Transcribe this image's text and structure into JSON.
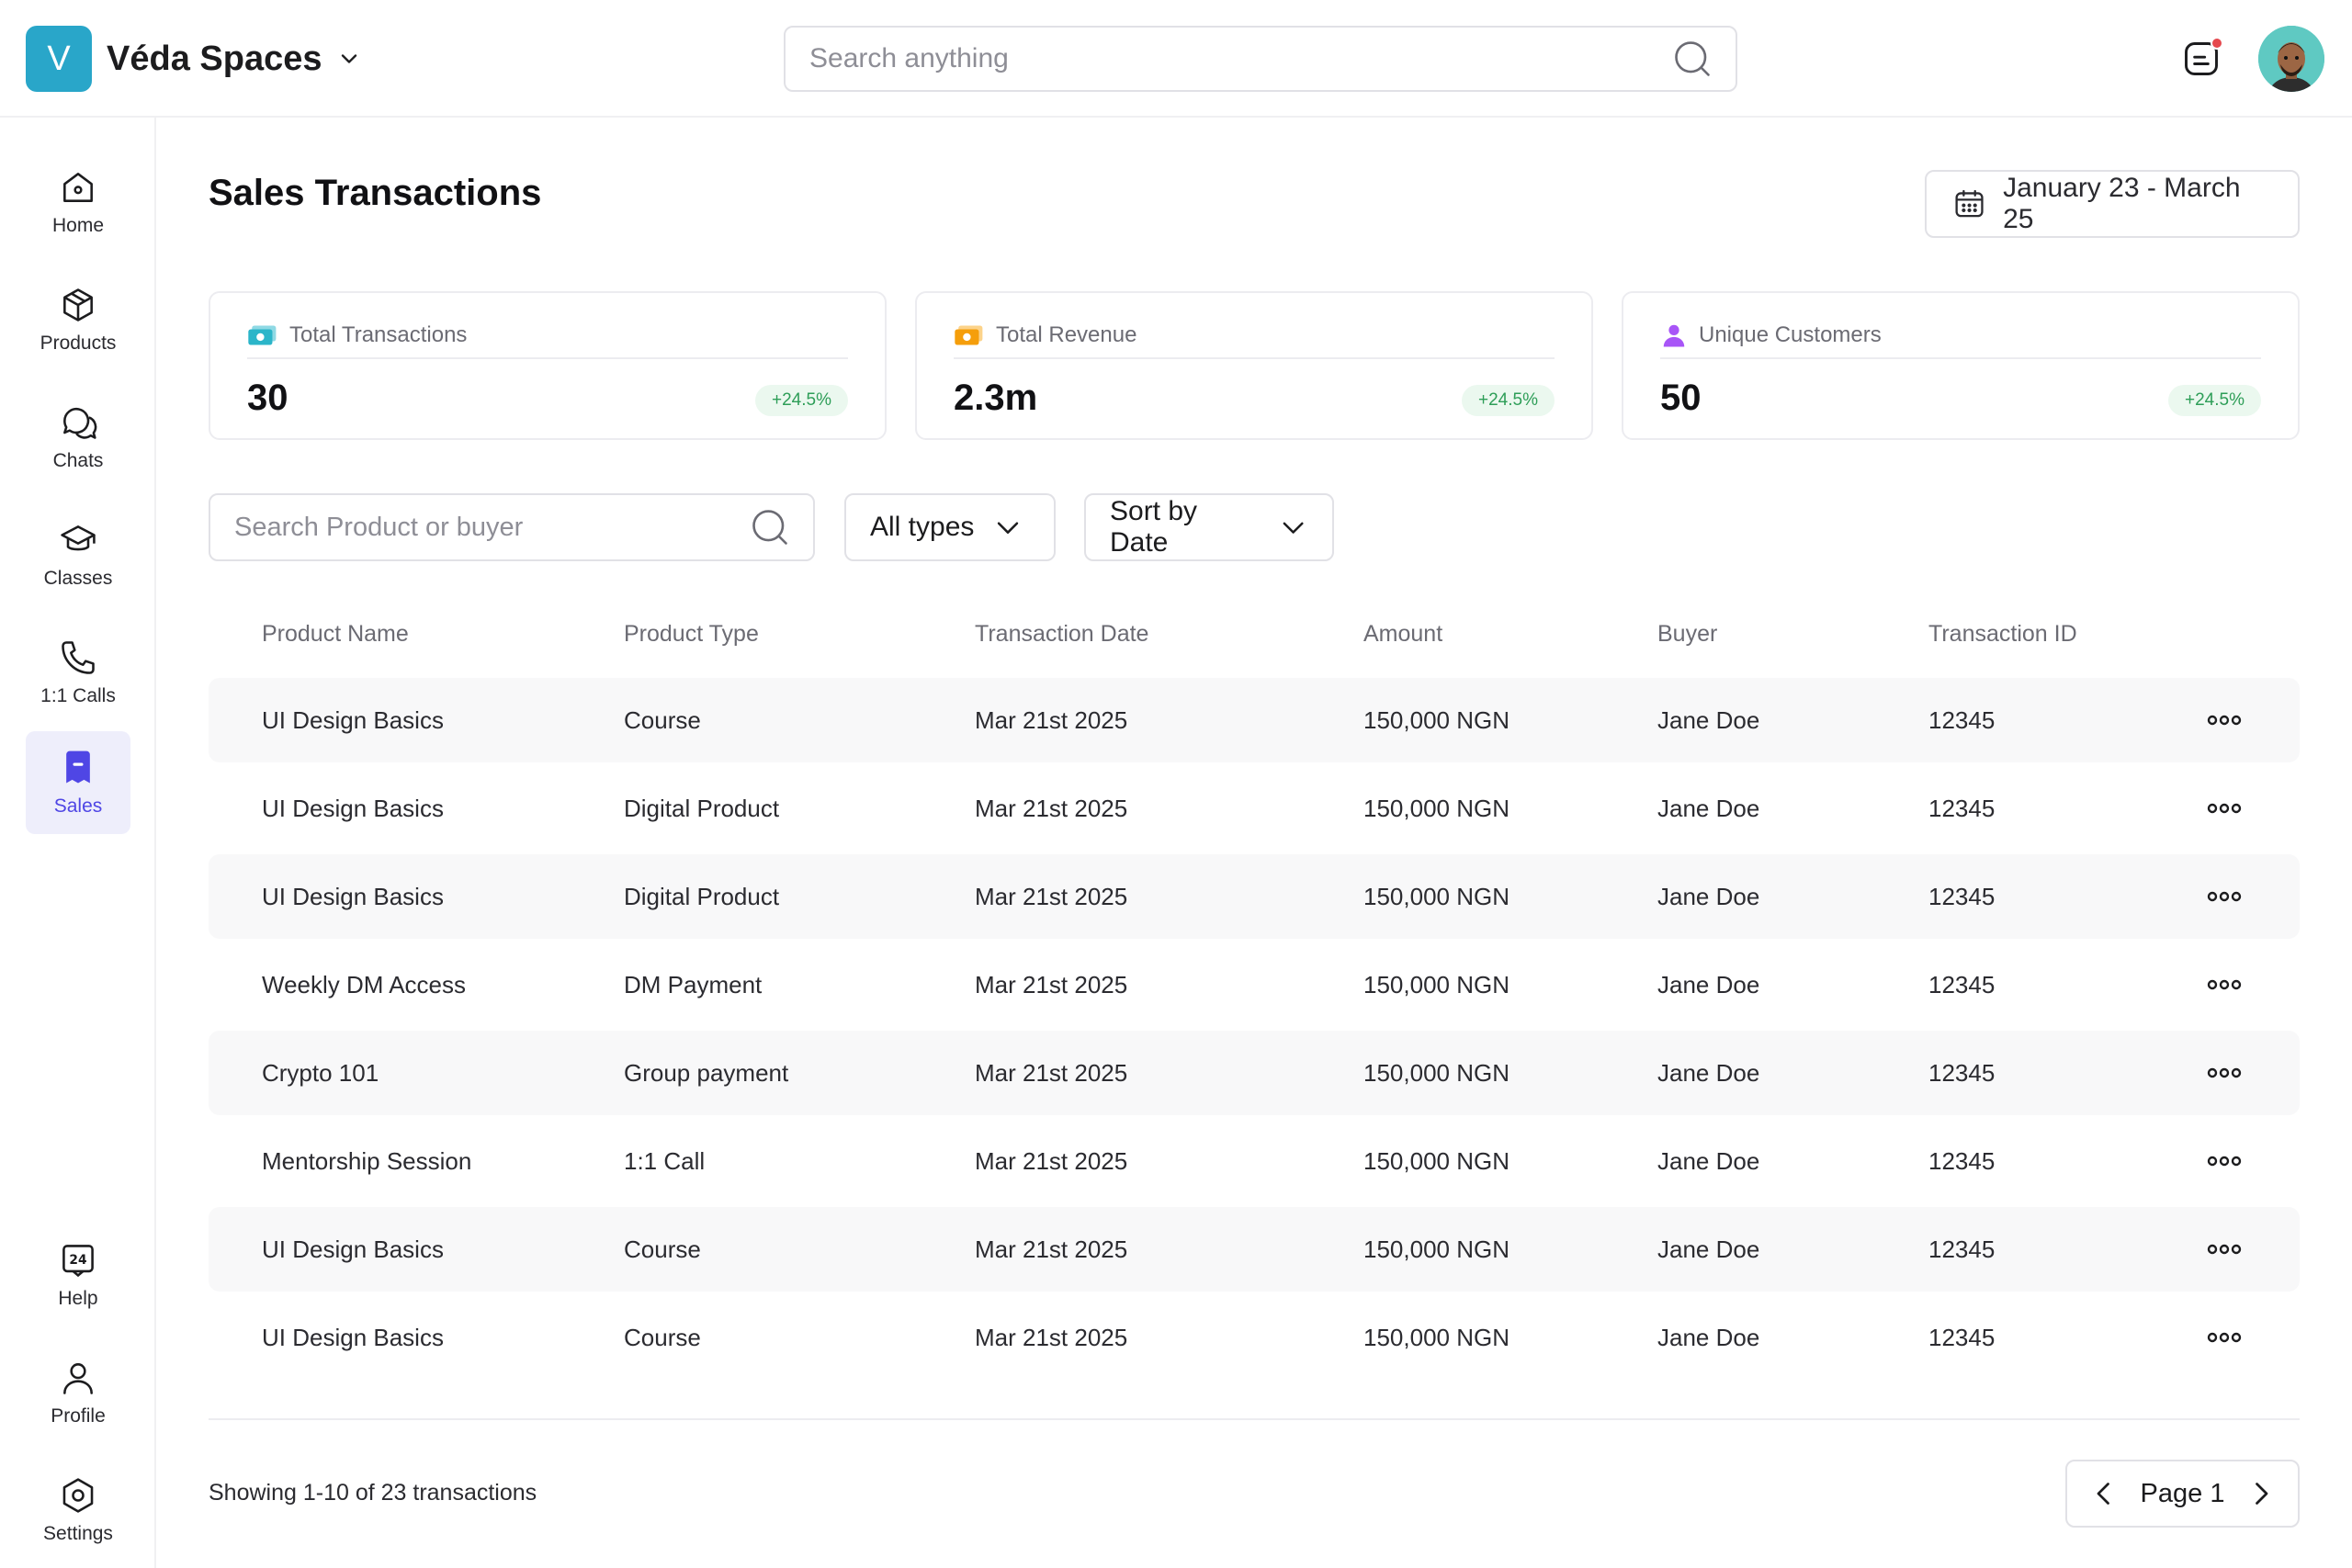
{
  "app": {
    "logo_letter": "V",
    "name": "Véda Spaces",
    "search_placeholder": "Search anything"
  },
  "sidebar": {
    "items": [
      {
        "label": "Home",
        "icon": "home-icon"
      },
      {
        "label": "Products",
        "icon": "box-icon"
      },
      {
        "label": "Chats",
        "icon": "chat-icon"
      },
      {
        "label": "Classes",
        "icon": "graduation-cap-icon"
      },
      {
        "label": "1:1 Calls",
        "icon": "phone-icon"
      },
      {
        "label": "Sales",
        "icon": "receipt-icon",
        "active": true
      }
    ],
    "bottom": [
      {
        "label": "Help",
        "icon": "help-24-icon"
      },
      {
        "label": "Profile",
        "icon": "user-icon"
      },
      {
        "label": "Settings",
        "icon": "gear-icon"
      }
    ]
  },
  "page": {
    "title": "Sales Transactions",
    "date_range": "January 23 - March 25"
  },
  "stats": [
    {
      "label": "Total Transactions",
      "value": "30",
      "change": "+24.5%",
      "icon": "cash-icon",
      "icon_color": "#2bb5c9"
    },
    {
      "label": "Total Revenue",
      "value": "2.3m",
      "change": "+24.5%",
      "icon": "cash-icon",
      "icon_color": "#f59e0b"
    },
    {
      "label": "Unique Customers",
      "value": "50",
      "change": "+24.5%",
      "icon": "user-icon",
      "icon_color": "#a855f7"
    }
  ],
  "filters": {
    "search_placeholder": "Search Product or buyer",
    "type_label": "All types",
    "sort_label": "Sort by Date"
  },
  "table": {
    "columns": [
      "Product Name",
      "Product Type",
      "Transaction Date",
      "Amount",
      "Buyer",
      "Transaction ID"
    ],
    "rows": [
      [
        "UI Design Basics",
        "Course",
        "Mar 21st 2025",
        "150,000 NGN",
        "Jane Doe",
        "12345"
      ],
      [
        "UI Design Basics",
        "Digital Product",
        "Mar 21st 2025",
        "150,000 NGN",
        "Jane Doe",
        "12345"
      ],
      [
        "UI Design Basics",
        "Digital Product",
        "Mar 21st 2025",
        "150,000 NGN",
        "Jane Doe",
        "12345"
      ],
      [
        "Weekly DM Access",
        "DM Payment",
        "Mar 21st 2025",
        "150,000 NGN",
        "Jane Doe",
        "12345"
      ],
      [
        "Crypto 101",
        "Group payment",
        "Mar 21st 2025",
        "150,000 NGN",
        "Jane Doe",
        "12345"
      ],
      [
        "Mentorship Session",
        "1:1 Call",
        "Mar 21st 2025",
        "150,000 NGN",
        "Jane Doe",
        "12345"
      ],
      [
        "UI Design Basics",
        "Course",
        "Mar 21st 2025",
        "150,000 NGN",
        "Jane Doe",
        "12345"
      ],
      [
        "UI Design Basics",
        "Course",
        "Mar 21st 2025",
        "150,000 NGN",
        "Jane Doe",
        "12345"
      ]
    ]
  },
  "footer": {
    "showing": "Showing 1-10 of 23 transactions",
    "page_label": "Page 1"
  },
  "colors": {
    "brand": "#29a6c9",
    "active_nav": "#4f46e5",
    "positive": "#2e9e58",
    "notification": "#e5484d"
  }
}
